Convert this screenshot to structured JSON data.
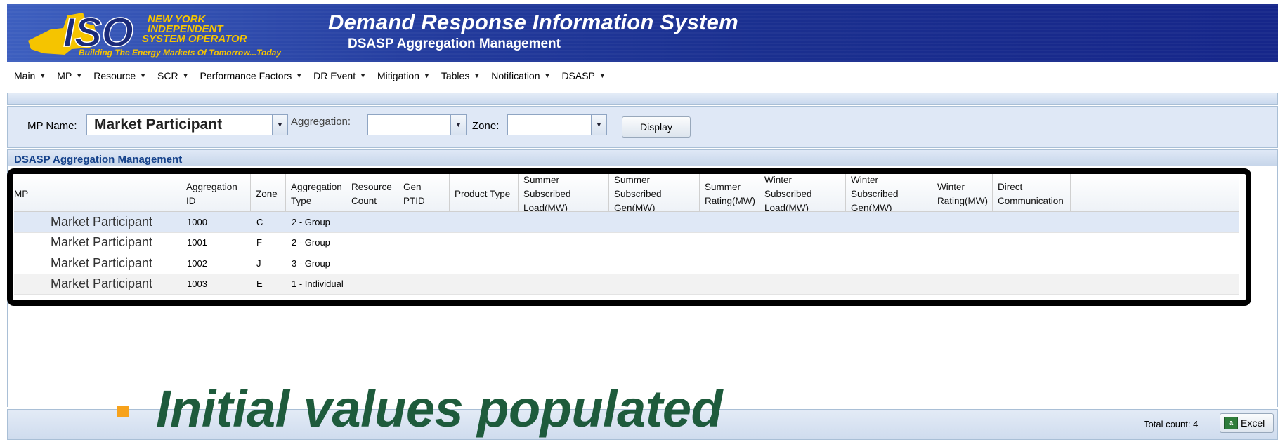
{
  "header": {
    "logo_text_1": "ISO",
    "logo_text_2": "NEW YORK",
    "logo_text_3": "INDEPENDENT",
    "logo_text_4": "SYSTEM OPERATOR",
    "logo_tagline": "Building The Energy Markets Of Tomorrow...Today",
    "title": "Demand Response Information System",
    "subtitle": "DSASP Aggregation Management"
  },
  "menu": [
    {
      "label": "Main"
    },
    {
      "label": "MP"
    },
    {
      "label": "Resource"
    },
    {
      "label": "SCR"
    },
    {
      "label": "Performance Factors"
    },
    {
      "label": "DR Event"
    },
    {
      "label": "Mitigation"
    },
    {
      "label": "Tables"
    },
    {
      "label": "Notification"
    },
    {
      "label": "DSASP"
    }
  ],
  "filters": {
    "mp_name_label": "MP Name:",
    "mp_name_value": "Market Participant",
    "aggregation_label": "Aggregation:",
    "aggregation_value": "",
    "zone_label": "Zone:",
    "zone_value": "",
    "display_button": "Display"
  },
  "grid": {
    "title": "DSASP Aggregation Management",
    "columns": [
      "MP",
      "Aggregation ID",
      "Zone",
      "Aggregation Type",
      "Resource Count",
      "Gen PTID",
      "Product Type",
      "Summer Subscribed Load(MW)",
      "Summer Subscribed Gen(MW)",
      "Summer Rating(MW)",
      "Winter Subscribed Load(MW)",
      "Winter Subscribed Gen(MW)",
      "Winter Rating(MW)",
      "Direct Communication"
    ],
    "rows": [
      {
        "mp": "Market Participant",
        "aggregation_id": "1000",
        "zone": "C",
        "type": "2 - Group"
      },
      {
        "mp": "Market Participant",
        "aggregation_id": "1001",
        "zone": "F",
        "type": "2 - Group"
      },
      {
        "mp": "Market Participant",
        "aggregation_id": "1002",
        "zone": "J",
        "type": "3 - Group"
      },
      {
        "mp": "Market Participant",
        "aggregation_id": "1003",
        "zone": "E",
        "type": "1 - Individual"
      }
    ]
  },
  "footer": {
    "total_count": "Total count: 4",
    "excel_button": "Excel",
    "excel_icon_glyph": "a"
  },
  "callout": {
    "text": "Initial values populated",
    "color": "#1e5b3c",
    "bullet_color": "#f7a21b"
  },
  "colors": {
    "banner": "#223a9c",
    "panel": "#dfe8f6",
    "grid_title": "#15428b"
  }
}
